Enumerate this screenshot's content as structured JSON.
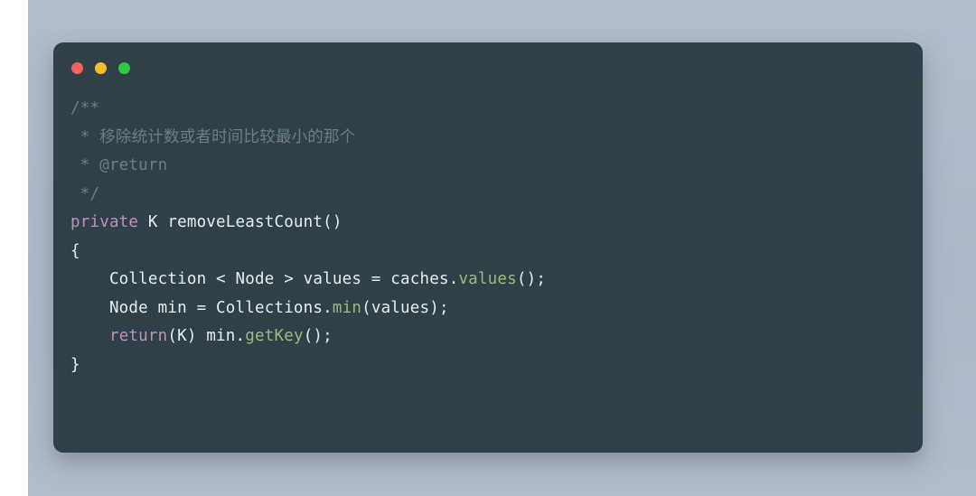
{
  "window": {
    "controls": [
      {
        "name": "close",
        "label": "Close",
        "color": "#f4605a"
      },
      {
        "name": "minimize",
        "label": "Minimize",
        "color": "#f5bc2e"
      },
      {
        "name": "maximize",
        "label": "Maximize",
        "color": "#2fc840"
      }
    ]
  },
  "theme": {
    "page_background": "#b0bacb",
    "card_background": "#2f4048",
    "text_color": "#e9eef0",
    "comment_color": "#6b7d85",
    "keyword_color": "#c28fc0",
    "method_color": "#9fb983"
  },
  "code": {
    "language": "Java",
    "lines": [
      {
        "tokens": [
          {
            "text": "/**",
            "type": "comment"
          }
        ]
      },
      {
        "tokens": [
          {
            "text": " * 移除统计数或者时间比较最小的那个",
            "type": "comment"
          }
        ]
      },
      {
        "tokens": [
          {
            "text": " * @return",
            "type": "comment"
          }
        ]
      },
      {
        "tokens": [
          {
            "text": " */",
            "type": "comment"
          }
        ]
      },
      {
        "tokens": [
          {
            "text": "private",
            "type": "keyword"
          },
          {
            "text": " K removeLeastCount()",
            "type": "plain"
          }
        ]
      },
      {
        "tokens": [
          {
            "text": "{",
            "type": "plain"
          }
        ]
      },
      {
        "tokens": [
          {
            "text": "    Collection < Node > values = caches.",
            "type": "plain"
          },
          {
            "text": "values",
            "type": "method"
          },
          {
            "text": "();",
            "type": "plain"
          }
        ]
      },
      {
        "tokens": [
          {
            "text": "    Node min = Collections.",
            "type": "plain"
          },
          {
            "text": "min",
            "type": "method"
          },
          {
            "text": "(values);",
            "type": "plain"
          }
        ]
      },
      {
        "tokens": [
          {
            "text": "    ",
            "type": "plain"
          },
          {
            "text": "return",
            "type": "keyword"
          },
          {
            "text": "(K) min.",
            "type": "plain"
          },
          {
            "text": "getKey",
            "type": "method"
          },
          {
            "text": "();",
            "type": "plain"
          }
        ]
      },
      {
        "tokens": [
          {
            "text": "}",
            "type": "plain"
          }
        ]
      }
    ]
  }
}
